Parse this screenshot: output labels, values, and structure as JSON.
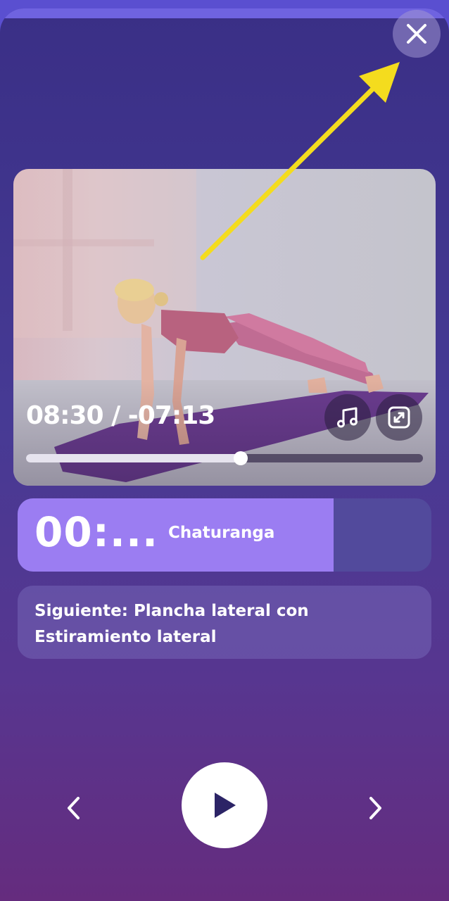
{
  "player": {
    "time_label": "08:30 / -07:13",
    "progress_fraction": 0.54
  },
  "exercise": {
    "countdown": "00:...",
    "name": "Chaturanga",
    "progress_fraction": 0.763
  },
  "next": {
    "text": "Siguiente: Plancha lateral con Estiramiento lateral"
  },
  "icons": {
    "close": "close-icon",
    "music": "music-note-icon",
    "expand": "expand-icon",
    "previous": "chevron-left-icon",
    "play": "play-icon",
    "next": "chevron-right-icon"
  },
  "colors": {
    "accent": "#9b7df2",
    "annotation_arrow": "#f4dc1e"
  }
}
